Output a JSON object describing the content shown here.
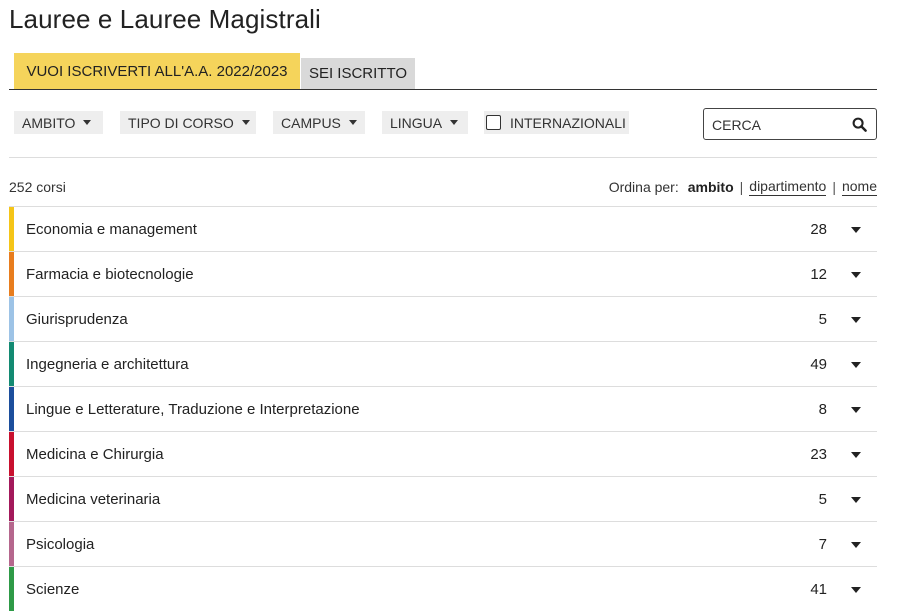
{
  "page": {
    "title": "Lauree e Lauree Magistrali"
  },
  "tabs": [
    {
      "label": "VUOI ISCRIVERTI ALL'A.A. 2022/2023",
      "active": true
    },
    {
      "label": "SEI ISCRITTO",
      "active": false
    }
  ],
  "filters": [
    {
      "label": "AMBITO"
    },
    {
      "label": "TIPO DI CORSO"
    },
    {
      "label": "CAMPUS"
    },
    {
      "label": "LINGUA"
    }
  ],
  "international_filter": {
    "label": "INTERNAZIONALI",
    "checked": false
  },
  "search": {
    "placeholder": "CERCA",
    "icon": "search-icon"
  },
  "results": {
    "count_text": "252 corsi"
  },
  "sort": {
    "label": "Ordina per:",
    "options": [
      {
        "label": "ambito",
        "active": true
      },
      {
        "label": "dipartimento",
        "active": false
      },
      {
        "label": "nome",
        "active": false
      }
    ],
    "separator": "|"
  },
  "categories": [
    {
      "name": "Economia e management",
      "count": "28",
      "color": "#f5c518"
    },
    {
      "name": "Farmacia e biotecnologie",
      "count": "12",
      "color": "#e87d1e"
    },
    {
      "name": "Giurisprudenza",
      "count": "5",
      "color": "#9dc3e6"
    },
    {
      "name": "Ingegneria e architettura",
      "count": "49",
      "color": "#138a72"
    },
    {
      "name": "Lingue e Letterature, Traduzione e Interpretazione",
      "count": "8",
      "color": "#1c4e9c"
    },
    {
      "name": "Medicina e Chirurgia",
      "count": "23",
      "color": "#c8102e"
    },
    {
      "name": "Medicina veterinaria",
      "count": "5",
      "color": "#a3195b"
    },
    {
      "name": "Psicologia",
      "count": "7",
      "color": "#b5678d"
    },
    {
      "name": "Scienze",
      "count": "41",
      "color": "#2e9a47"
    }
  ]
}
